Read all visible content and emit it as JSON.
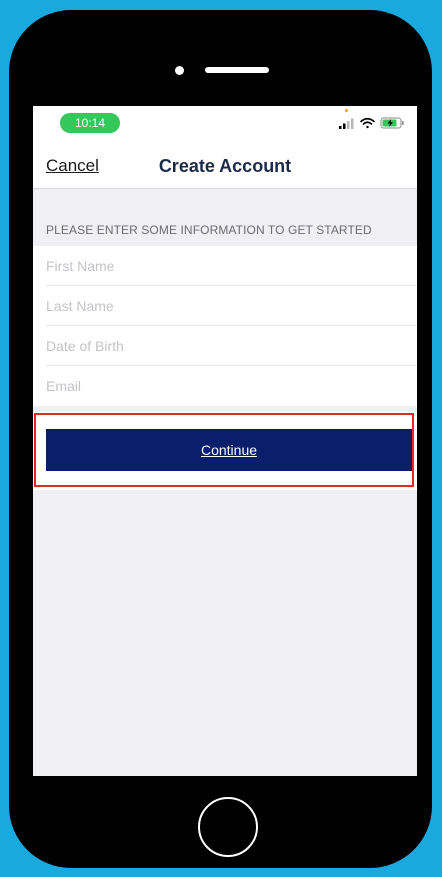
{
  "status_bar": {
    "time": "10:14",
    "icons": [
      "signal-icon",
      "wifi-icon",
      "battery-charging-icon"
    ]
  },
  "nav": {
    "cancel_label": "Cancel",
    "title": "Create Account"
  },
  "form": {
    "section_header": "PLEASE ENTER SOME INFORMATION TO GET STARTED",
    "fields": [
      {
        "placeholder": "First Name",
        "value": ""
      },
      {
        "placeholder": "Last Name",
        "value": ""
      },
      {
        "placeholder": "Date of Birth",
        "value": ""
      },
      {
        "placeholder": "Email",
        "value": ""
      }
    ]
  },
  "actions": {
    "continue_label": "Continue"
  },
  "colors": {
    "background": "#1aa9df",
    "time_pill": "#34c759",
    "continue_button": "#0a1f6b",
    "highlight": "#e8262a"
  }
}
